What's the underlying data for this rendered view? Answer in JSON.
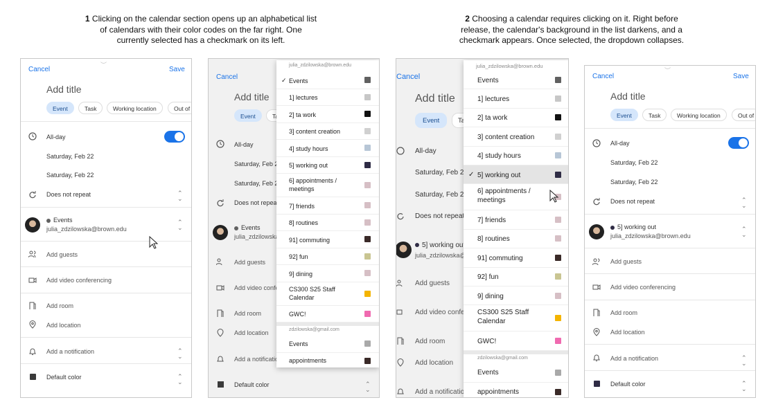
{
  "captions": [
    {
      "num": "1",
      "text": "Clicking on the calendar section opens up an alphabetical list of calendars with their color codes on the far right. One currently selected has a checkmark on its left."
    },
    {
      "num": "2",
      "text": "Choosing a calendar requires clicking on it. Right before release, the calendar's background in the list darkens, and a checkmark appears. Once selected, the dropdown collapses."
    }
  ],
  "form": {
    "cancel": "Cancel",
    "save": "Save",
    "title_placeholder": "Add title",
    "chips": [
      "Event",
      "Task",
      "Working location",
      "Out of"
    ],
    "allday": "All-day",
    "date1": "Saturday, Feb 22",
    "date2": "Saturday, Feb 22",
    "repeat": "Does not repeat",
    "guests": "Add guests",
    "video": "Add video conferencing",
    "room": "Add room",
    "location": "Add location",
    "notification": "Add a notification",
    "color": "Default color",
    "email": "julia_zdzilowska@brown.edu"
  },
  "screen1": {
    "calendar": "Events"
  },
  "screen4": {
    "calendar": "5] working out"
  },
  "dropdown": {
    "account1": "julia_zdzilowska@brown.edu",
    "account2": "zdzilowska@gmail.com",
    "items": [
      {
        "label": "Events",
        "color": "#616161"
      },
      {
        "label": "1] lectures",
        "color": "#c7c7c7"
      },
      {
        "label": "2] ta work",
        "color": "#111111"
      },
      {
        "label": "3] content creation",
        "color": "#d0d0d0"
      },
      {
        "label": "4] study hours",
        "color": "#b7c6d6"
      },
      {
        "label": "5] working out",
        "color": "#2f2c45"
      },
      {
        "label": "6] appointments / meetings",
        "color": "#d6bfc5"
      },
      {
        "label": "7] friends",
        "color": "#d6bfc5"
      },
      {
        "label": "8] routines",
        "color": "#d6bfc5"
      },
      {
        "label": "91] commuting",
        "color": "#3a2a28"
      },
      {
        "label": "92] fun",
        "color": "#c9c592"
      },
      {
        "label": "9] dining",
        "color": "#d6bfc5"
      },
      {
        "label": "CS300 S25 Staff Calendar",
        "color": "#f4b400"
      },
      {
        "label": "GWC!",
        "color": "#f06ab0"
      }
    ],
    "gmail_items": [
      {
        "label": "Events",
        "color": "#a9a9a9"
      },
      {
        "label": "appointments",
        "color": "#3a2a28"
      }
    ],
    "checkmark": "✓"
  },
  "colors": {
    "accent": "#1a73e8",
    "selected_chip": "#d5e6fb"
  }
}
